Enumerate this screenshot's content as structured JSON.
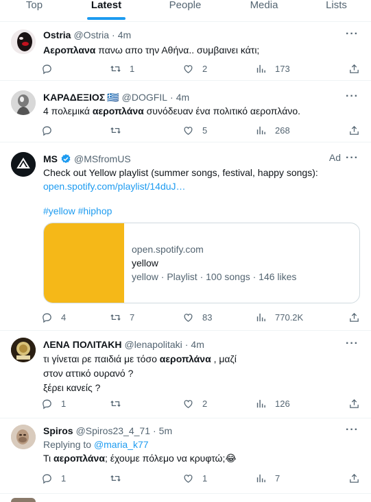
{
  "tabs": [
    {
      "label": "Top"
    },
    {
      "label": "Latest"
    },
    {
      "label": "People"
    },
    {
      "label": "Media"
    },
    {
      "label": "Lists"
    }
  ],
  "tweets": [
    {
      "name": "Ostria",
      "handle": "@Ostria",
      "sep": "·",
      "time": "4m",
      "text_bold": "Αεροπλανα",
      "text_rest": " πανω απο την Αθήνα.. συμβαινει κάτι;",
      "replies": "",
      "retweets": "1",
      "likes": "2",
      "views": "173"
    },
    {
      "name": "ΚΑΡΑΔΕΞΙΟΣ",
      "flag": "🇬🇷",
      "handle": "@DOGFIL",
      "sep": "·",
      "time": "4m",
      "text_pre": "4 πολεμικά ",
      "text_bold": "αεροπλάνα",
      "text_rest": " συνόδευαν ένα πολιτικό αεροπλάνο.",
      "replies": "",
      "retweets": "",
      "likes": "5",
      "views": "268"
    },
    {
      "name": "MS",
      "handle": "@MSfromUS",
      "ad": "Ad",
      "text": "Check out Yellow playlist (summer songs, festival, happy songs):",
      "link": "open.spotify.com/playlist/14duJ…",
      "hashtags": "#yellow #hiphop",
      "card": {
        "domain": "open.spotify.com",
        "title": "yellow",
        "desc": "yellow · Playlist · 100 songs · 146 likes",
        "image_color": "#f5b818"
      },
      "replies": "4",
      "retweets": "7",
      "likes": "83",
      "views": "770.2K"
    },
    {
      "name": "ΛΕΝΑ ΠΟΛΙΤΑΚΗ",
      "handle": "@lenapolitaki",
      "sep": "·",
      "time": "4m",
      "line1_pre": "τι γίνεται ρε παιδιά με τόσο ",
      "line1_bold": "αεροπλάνα",
      "line1_rest": " , μαζί",
      "line2": "στον αττικό ουρανό ?",
      "line3": "ξέρει κανείς ?",
      "replies": "1",
      "retweets": "",
      "likes": "2",
      "views": "126"
    },
    {
      "name": "Spiros",
      "handle": "@Spiros23_4_71",
      "sep": "·",
      "time": "5m",
      "replying_label": "Replying to ",
      "replying_handle": "@maria_k77",
      "text_pre": "Τι ",
      "text_bold": "αεροπλάνα",
      "text_rest": "; έχουμε πόλεμο να κρυφτώ;😂",
      "replies": "1",
      "retweets": "",
      "likes": "1",
      "views": "7"
    }
  ],
  "colors": {
    "accent": "#1d9bf0",
    "text": "#0f1419",
    "muted": "#536471",
    "border": "#eff3f4",
    "verified": "#1d9bf0"
  },
  "icons": [
    "reply-icon",
    "retweet-icon",
    "like-icon",
    "views-icon",
    "share-icon",
    "more-icon",
    "verified-icon"
  ]
}
